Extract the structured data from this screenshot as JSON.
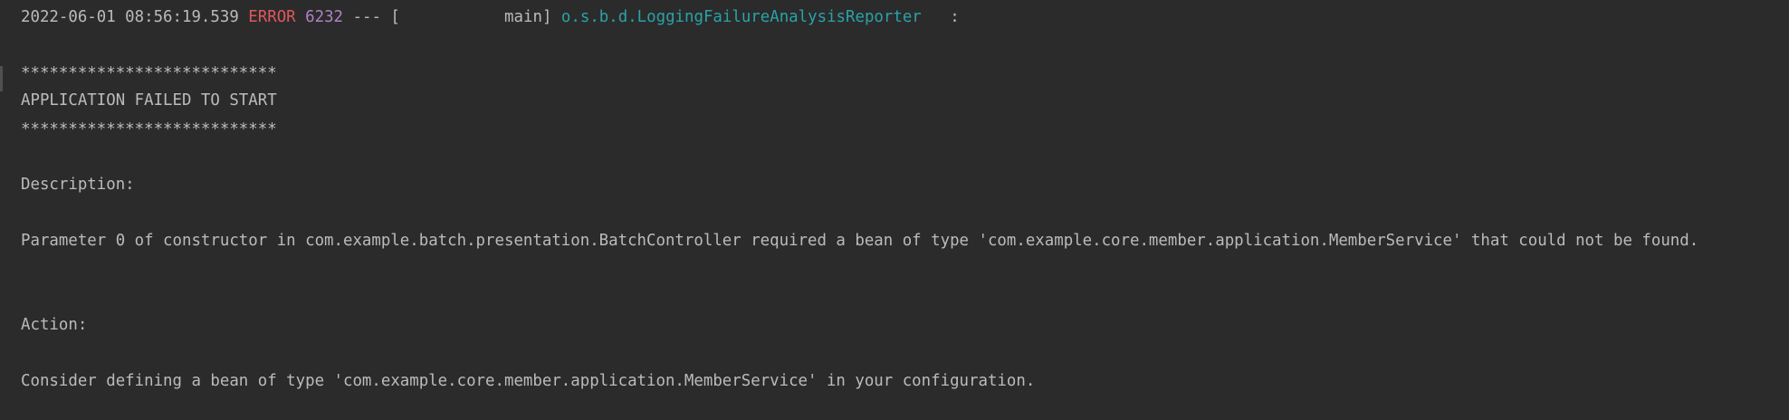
{
  "console": {
    "log_header": {
      "timestamp": "2022-06-01 08:56:19.539",
      "level": "ERROR",
      "pid": "6232",
      "separator": "---",
      "thread": "[           main]",
      "logger": "o.s.b.d.LoggingFailureAnalysisReporter",
      "colon": ":"
    },
    "lines": {
      "banner_top": "***************************",
      "banner_title": "APPLICATION FAILED TO START",
      "banner_bottom": "***************************",
      "description_label": "Description:",
      "description_text": "Parameter 0 of constructor in com.example.batch.presentation.BatchController required a bean of type 'com.example.core.member.application.MemberService' that could not be found.",
      "action_label": "Action:",
      "action_text": "Consider defining a bean of type 'com.example.core.member.application.MemberService' in your configuration."
    }
  },
  "colors": {
    "background": "#2b2b2b",
    "text": "#bbbbbb",
    "error": "#e0575b",
    "pid": "#b081c4",
    "logger": "#2aa2a8"
  }
}
